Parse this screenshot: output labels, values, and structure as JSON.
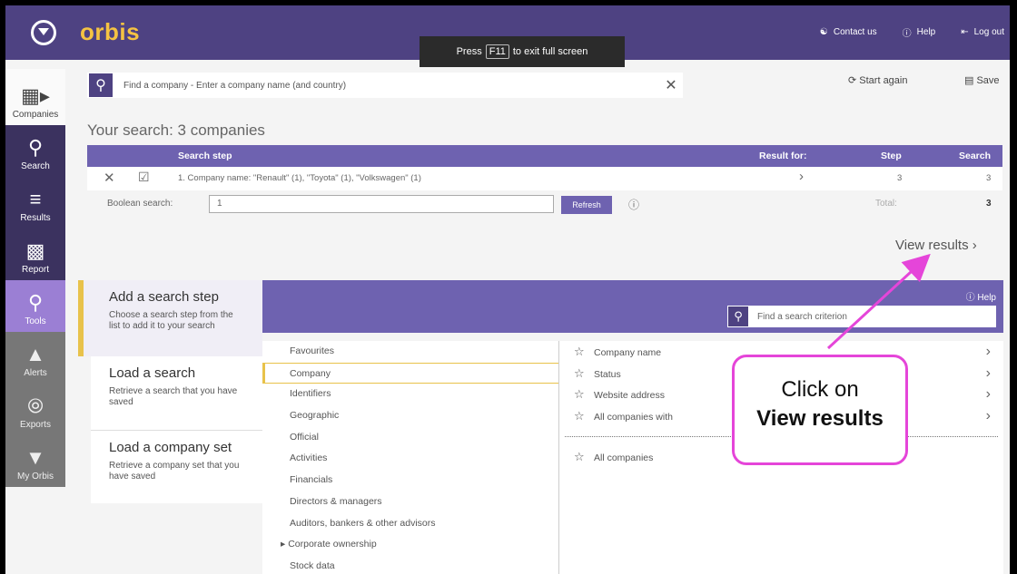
{
  "header": {
    "brand": "orbis",
    "fullscreen_pre": "Press",
    "fullscreen_key": "F11",
    "fullscreen_post": "to exit full screen",
    "links": [
      {
        "label": "Contact us",
        "icon": "person-icon"
      },
      {
        "label": "Help",
        "icon": "help-icon"
      },
      {
        "label": "Log out",
        "icon": "logout-icon"
      }
    ]
  },
  "sidebar": {
    "items": [
      {
        "label": "Companies",
        "icon": "companies-icon"
      },
      {
        "label": "Search",
        "icon": "search-icon"
      },
      {
        "label": "Results",
        "icon": "results-icon"
      },
      {
        "label": "Report",
        "icon": "report-icon"
      },
      {
        "label": "Tools",
        "icon": "tools-icon"
      },
      {
        "label": "Alerts",
        "icon": "bell-icon"
      },
      {
        "label": "Exports",
        "icon": "export-icon"
      },
      {
        "label": "My Orbis",
        "icon": "my-orbis-icon"
      }
    ]
  },
  "search": {
    "placeholder": "Find a company - Enter a company name (and country)"
  },
  "actions": {
    "start_again": "Start again",
    "save": "Save"
  },
  "your_search": "Your search: 3 companies",
  "table": {
    "headers": {
      "step": "Search step",
      "result_for": "Result for:",
      "step_col": "Step",
      "search_col": "Search"
    },
    "row": {
      "text": "1. Company name: \"Renault\" (1), \"Toyota\" (1), \"Volkswagen\" (1)",
      "step": "3",
      "search": "3"
    },
    "boolean_label": "Boolean search:",
    "boolean_value": "1",
    "refresh": "Refresh",
    "total_label": "Total:",
    "total_value": "3"
  },
  "view_results": "View results",
  "panel": {
    "cards": [
      {
        "title": "Add a search step",
        "desc": "Choose a search step from the list to add it to your search"
      },
      {
        "title": "Load a search",
        "desc": "Retrieve a search that you have saved"
      },
      {
        "title": "Load a company set",
        "desc": "Retrieve a company set that you have saved"
      }
    ],
    "help": "Help",
    "criteria_placeholder": "Find a search criterion",
    "categories": [
      "Favourites",
      "Company",
      "Identifiers",
      "Geographic",
      "Official",
      "Activities",
      "Financials",
      "Directors & managers",
      "Auditors, bankers & other advisors",
      "Corporate ownership",
      "Stock data"
    ],
    "criteria": [
      "Company name",
      "Status",
      "Website address",
      "All companies with"
    ],
    "all_companies": "All companies"
  },
  "annotation": {
    "line1": "Click on",
    "line2": "View results",
    "color": "#e545d9"
  },
  "colors": {
    "topbar": "#4e4282",
    "accent": "#6e62b0",
    "brand": "#f5c342",
    "highlight": "#e8c24a"
  }
}
